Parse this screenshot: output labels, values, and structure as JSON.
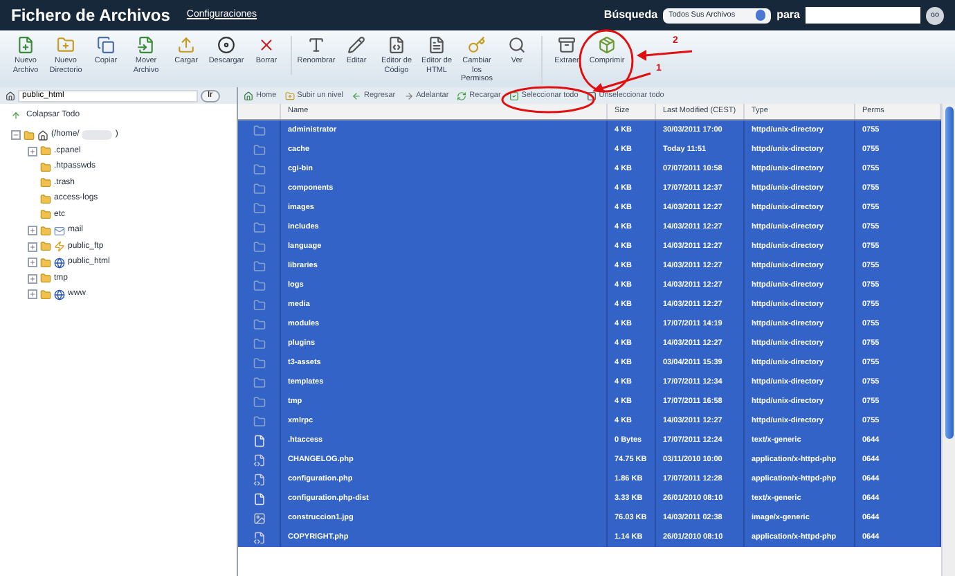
{
  "header": {
    "title": "Fichero de Archivos",
    "settings_link": "Configuraciones",
    "search_label": "Búsqueda",
    "search_scope": "Todos Sus Archivos",
    "for_label": "para",
    "go_button": "GO"
  },
  "toolbar": [
    [
      {
        "label": "Nuevo Archivo",
        "kind": "new-file"
      },
      {
        "label": "Nuevo Directorio",
        "kind": "new-folder"
      },
      {
        "label": "Copiar",
        "kind": "copy"
      },
      {
        "label": "Mover Archivo",
        "kind": "move"
      },
      {
        "label": "Cargar",
        "kind": "upload"
      },
      {
        "label": "Descargar",
        "kind": "download"
      },
      {
        "label": "Borrar",
        "kind": "delete"
      }
    ],
    [
      {
        "label": "Renombrar",
        "kind": "rename"
      },
      {
        "label": "Editar",
        "kind": "edit"
      },
      {
        "label": "Editor de Código",
        "kind": "code"
      },
      {
        "label": "Editor de HTML",
        "kind": "html"
      },
      {
        "label": "Cambiar los Permisos",
        "kind": "key"
      },
      {
        "label": "Ver",
        "kind": "view"
      }
    ],
    [
      {
        "label": "Extraer",
        "kind": "extract"
      },
      {
        "label": "Comprimir",
        "kind": "compress"
      }
    ]
  ],
  "path_field": {
    "value": "public_html",
    "go_button": "Ir"
  },
  "collapse_all": "Colapsar Todo",
  "tree": {
    "label": "(/home/",
    "suffix": ")",
    "expanded": true,
    "children": [
      {
        "label": ".cpanel",
        "expandable": true,
        "kind": "folder"
      },
      {
        "label": ".htpasswds",
        "expandable": false,
        "kind": "folder"
      },
      {
        "label": ".trash",
        "expandable": false,
        "kind": "folder"
      },
      {
        "label": "access-logs",
        "expandable": false,
        "kind": "folder"
      },
      {
        "label": "etc",
        "expandable": false,
        "kind": "folder"
      },
      {
        "label": "mail",
        "expandable": true,
        "kind": "mail"
      },
      {
        "label": "public_ftp",
        "expandable": true,
        "kind": "ftp"
      },
      {
        "label": "public_html",
        "expandable": true,
        "kind": "web"
      },
      {
        "label": "tmp",
        "expandable": true,
        "kind": "folder"
      },
      {
        "label": "www",
        "expandable": true,
        "kind": "web"
      }
    ]
  },
  "nav": [
    {
      "label": "Home",
      "kind": "home"
    },
    {
      "label": "Subir un nivel",
      "kind": "up"
    },
    {
      "label": "Regresar",
      "kind": "back"
    },
    {
      "label": "Adelantar",
      "kind": "forward"
    },
    {
      "label": "Recargar",
      "kind": "reload"
    },
    {
      "label": "Seleccionar todo",
      "kind": "select-all"
    },
    {
      "label": "Unseleccionar todo",
      "kind": "unselect-all"
    }
  ],
  "table": {
    "columns": [
      "Name",
      "Size",
      "Last Modified (CEST)",
      "Type",
      "Perms"
    ],
    "rows": [
      {
        "kind": "folder",
        "selected": true,
        "cells": [
          "administrator",
          "4 KB",
          "30/03/2011 17:00",
          "httpd/unix-directory",
          "0755"
        ]
      },
      {
        "kind": "folder",
        "selected": true,
        "cells": [
          "cache",
          "4 KB",
          "Today 11:51",
          "httpd/unix-directory",
          "0755"
        ]
      },
      {
        "kind": "folder",
        "selected": true,
        "cells": [
          "cgi-bin",
          "4 KB",
          "07/07/2011 10:58",
          "httpd/unix-directory",
          "0755"
        ]
      },
      {
        "kind": "folder",
        "selected": true,
        "cells": [
          "components",
          "4 KB",
          "17/07/2011 12:37",
          "httpd/unix-directory",
          "0755"
        ]
      },
      {
        "kind": "folder",
        "selected": true,
        "cells": [
          "images",
          "4 KB",
          "14/03/2011 12:27",
          "httpd/unix-directory",
          "0755"
        ]
      },
      {
        "kind": "folder",
        "selected": true,
        "cells": [
          "includes",
          "4 KB",
          "14/03/2011 12:27",
          "httpd/unix-directory",
          "0755"
        ]
      },
      {
        "kind": "folder",
        "selected": true,
        "cells": [
          "language",
          "4 KB",
          "14/03/2011 12:27",
          "httpd/unix-directory",
          "0755"
        ]
      },
      {
        "kind": "folder",
        "selected": true,
        "cells": [
          "libraries",
          "4 KB",
          "14/03/2011 12:27",
          "httpd/unix-directory",
          "0755"
        ]
      },
      {
        "kind": "folder",
        "selected": true,
        "cells": [
          "logs",
          "4 KB",
          "14/03/2011 12:27",
          "httpd/unix-directory",
          "0755"
        ]
      },
      {
        "kind": "folder",
        "selected": true,
        "cells": [
          "media",
          "4 KB",
          "14/03/2011 12:27",
          "httpd/unix-directory",
          "0755"
        ]
      },
      {
        "kind": "folder",
        "selected": true,
        "cells": [
          "modules",
          "4 KB",
          "17/07/2011 14:19",
          "httpd/unix-directory",
          "0755"
        ]
      },
      {
        "kind": "folder",
        "selected": true,
        "cells": [
          "plugins",
          "4 KB",
          "14/03/2011 12:27",
          "httpd/unix-directory",
          "0755"
        ]
      },
      {
        "kind": "folder",
        "selected": true,
        "cells": [
          "t3-assets",
          "4 KB",
          "03/04/2011 15:39",
          "httpd/unix-directory",
          "0755"
        ]
      },
      {
        "kind": "folder",
        "selected": true,
        "cells": [
          "templates",
          "4 KB",
          "17/07/2011 12:34",
          "httpd/unix-directory",
          "0755"
        ]
      },
      {
        "kind": "folder",
        "selected": true,
        "cells": [
          "tmp",
          "4 KB",
          "17/07/2011 16:58",
          "httpd/unix-directory",
          "0755"
        ]
      },
      {
        "kind": "folder",
        "selected": true,
        "cells": [
          "xmlrpc",
          "4 KB",
          "14/03/2011 12:27",
          "httpd/unix-directory",
          "0755"
        ]
      },
      {
        "kind": "text",
        "selected": true,
        "cells": [
          ".htaccess",
          "0 Bytes",
          "17/07/2011 12:24",
          "text/x-generic",
          "0644"
        ]
      },
      {
        "kind": "php",
        "selected": true,
        "cells": [
          "CHANGELOG.php",
          "74.75 KB",
          "03/11/2010 10:00",
          "application/x-httpd-php",
          "0644"
        ]
      },
      {
        "kind": "php",
        "selected": true,
        "cells": [
          "configuration.php",
          "1.86 KB",
          "17/07/2011 12:28",
          "application/x-httpd-php",
          "0644"
        ]
      },
      {
        "kind": "text",
        "selected": true,
        "cells": [
          "configuration.php-dist",
          "3.33 KB",
          "26/01/2010 08:10",
          "text/x-generic",
          "0644"
        ]
      },
      {
        "kind": "image",
        "selected": true,
        "cells": [
          "construccion1.jpg",
          "76.03 KB",
          "14/03/2011 02:38",
          "image/x-generic",
          "0644"
        ]
      },
      {
        "kind": "php",
        "selected": true,
        "cells": [
          "COPYRIGHT.php",
          "1.14 KB",
          "26/01/2010 08:10",
          "application/x-httpd-php",
          "0644"
        ]
      }
    ]
  },
  "annotations": [
    {
      "label": "2"
    },
    {
      "label": "1"
    }
  ]
}
